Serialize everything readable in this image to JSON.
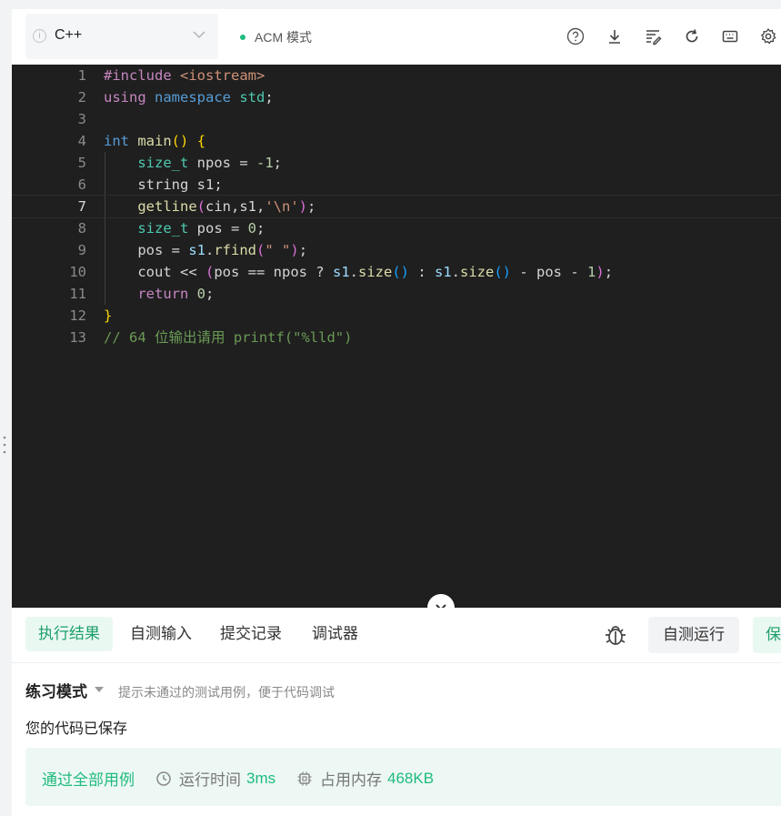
{
  "toolbar": {
    "language": "C++",
    "mode": "ACM 模式",
    "icons": [
      "help-icon",
      "download-icon",
      "format-icon",
      "reset-icon",
      "keyboard-icon",
      "settings-icon"
    ]
  },
  "editor": {
    "line_numbers": [
      "1",
      "2",
      "3",
      "4",
      "5",
      "6",
      "7",
      "8",
      "9",
      "10",
      "11",
      "12",
      "13"
    ],
    "current_line": 7,
    "lines": [
      "#include <iostream>",
      "using namespace std;",
      "",
      "int main() {",
      "    size_t npos = -1;",
      "    string s1;",
      "    getline(cin,s1,'\\n');",
      "    size_t pos = 0;",
      "    pos = s1.rfind(\" \");",
      "    cout << (pos == npos ? s1.size() : s1.size() - pos - 1);",
      "    return 0;",
      "}",
      "// 64 位输出请用 printf(\"%lld\")"
    ]
  },
  "tabs": [
    "执行结果",
    "自测输入",
    "提交记录",
    "调试器"
  ],
  "actions": {
    "self_run": "自测运行",
    "save": "保"
  },
  "result": {
    "mode": "练习模式",
    "hint": "提示未通过的测试用例，便于代码调试",
    "saved": "您的代码已保存",
    "status": "通过全部用例",
    "time_label": "运行时间",
    "time_value": "3ms",
    "memory_label": "占用内存",
    "memory_value": "468KB"
  },
  "colors": {
    "accent": "#1fba7e",
    "editor_bg": "#1f1f1f"
  }
}
